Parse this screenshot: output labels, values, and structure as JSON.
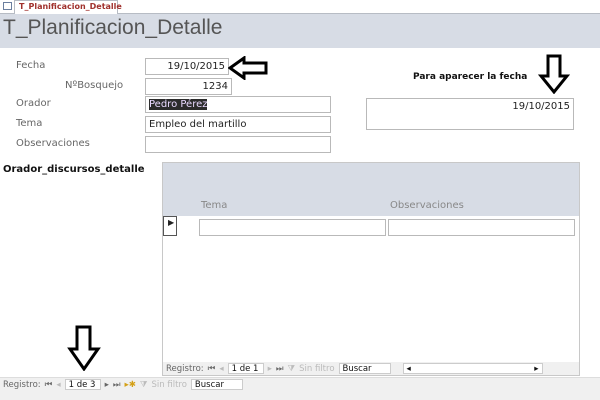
{
  "tab": {
    "label": "T_Planificacion_Detalle"
  },
  "form": {
    "title": "T_Planificacion_Detalle",
    "fields": {
      "fecha_label": "Fecha",
      "fecha": "19/10/2015",
      "bosquejo_label": "NºBosquejo",
      "bosquejo": "1234",
      "orador_label": "Orador",
      "orador": "Pedro Pérez",
      "tema_label": "Tema",
      "tema": "Empleo del martillo",
      "obs_label": "Observaciones",
      "obs": ""
    },
    "note_label": "Para aparecer la fecha",
    "note_value": "19/10/2015"
  },
  "subform": {
    "label": "Orador_discursos_detalle",
    "columns": [
      "Tema",
      "Observaciones"
    ],
    "nav": {
      "label": "Registro:",
      "position": "1 de 1",
      "filter": "Sin filtro",
      "search": "Buscar"
    }
  },
  "main_nav": {
    "label": "Registro:",
    "position": "1 de 3",
    "filter": "Sin filtro",
    "search": "Buscar"
  }
}
